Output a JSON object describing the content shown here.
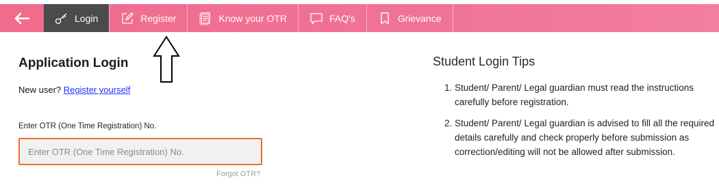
{
  "nav": {
    "back_icon": "left-arrow-icon",
    "tabs": [
      {
        "label": "Login",
        "icon": "key-icon",
        "active": true
      },
      {
        "label": "Register",
        "icon": "edit-icon",
        "active": false
      },
      {
        "label": "Know your OTR",
        "icon": "document-icon",
        "active": false
      },
      {
        "label": "FAQ's",
        "icon": "chat-icon",
        "active": false
      },
      {
        "label": "Grievance",
        "icon": "bookmark-icon",
        "active": false
      }
    ]
  },
  "login": {
    "title": "Application Login",
    "new_user_text": "New user?",
    "register_link": "Register yourself",
    "otr_label": "Enter OTR (One Time Registration) No.",
    "otr_placeholder": "Enter OTR (One Time Registration) No.",
    "forgot_link": "Forgot OTR?"
  },
  "tips": {
    "title": "Student Login Tips",
    "items": [
      "Student/ Parent/ Legal guardian must read the instructions carefully before registration.",
      "Student/ Parent/ Legal guardian is advised to fill all the required details carefully and check properly before submission as correction/editing will not be allowed after submission."
    ]
  },
  "colors": {
    "nav_bg": "#f06b8c",
    "active_tab": "#4b4b4b",
    "input_border": "#ee6b2f",
    "link": "#1a33ff"
  }
}
